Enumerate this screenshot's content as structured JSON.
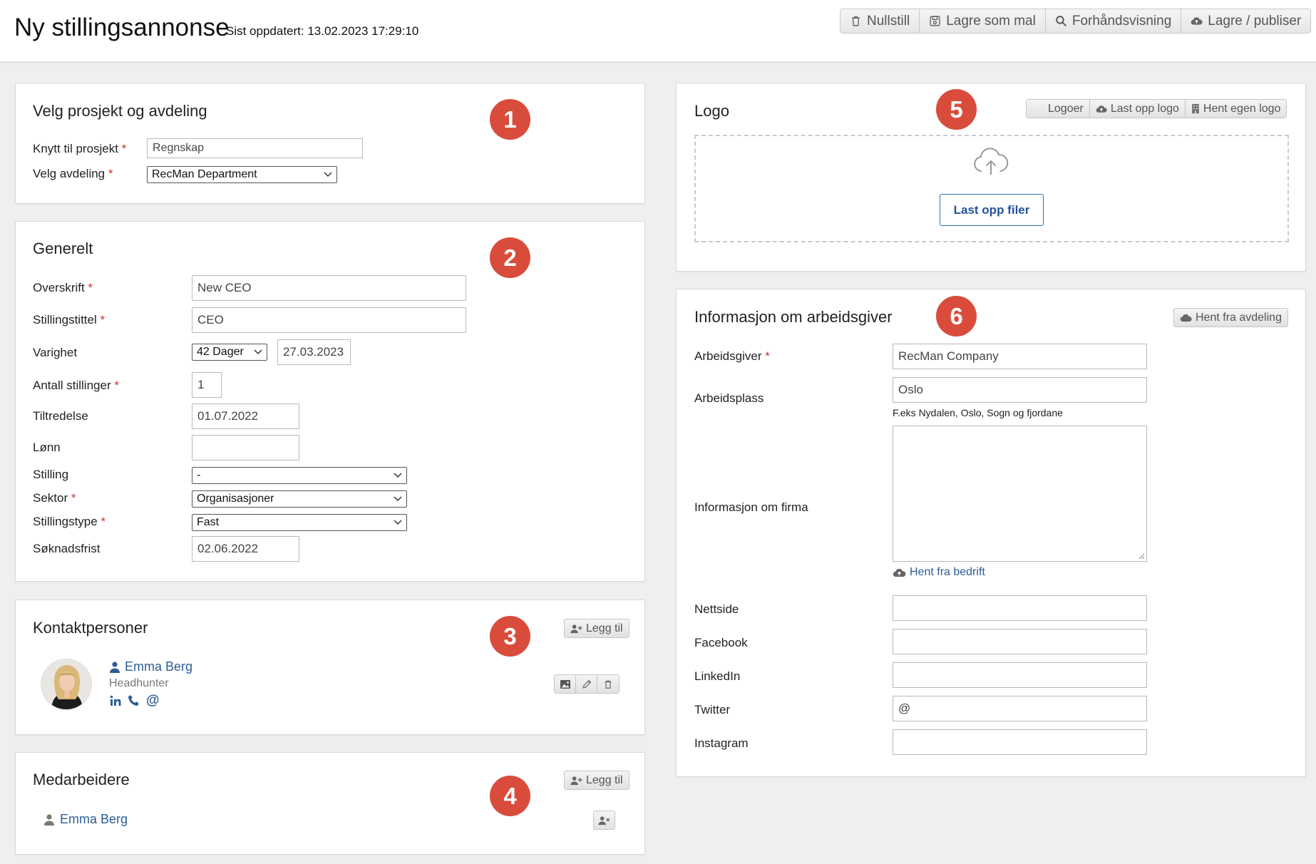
{
  "header": {
    "title": "Ny stillingsannonse",
    "last_updated": "Sist oppdatert: 13.02.2023 17:29:10",
    "toolbar": {
      "reset": "Nullstill",
      "save_template": "Lagre som mal",
      "preview": "Forhåndsvisning",
      "publish": "Lagre / publiser"
    }
  },
  "badges": [
    "1",
    "2",
    "3",
    "4",
    "5",
    "6"
  ],
  "project": {
    "title": "Velg prosjekt og avdeling",
    "project_label": "Knytt til prosjekt",
    "project_value": "Regnskap",
    "department_label": "Velg avdeling",
    "department_value": "RecMan Department"
  },
  "general": {
    "title": "Generelt",
    "headline_label": "Overskrift",
    "headline_value": "New CEO",
    "job_title_label": "Stillingstittel",
    "job_title_value": "CEO",
    "duration_label": "Varighet",
    "duration_value": "42 Dager",
    "duration_date": "27.03.2023",
    "positions_label": "Antall stillinger",
    "positions_value": "1",
    "start_label": "Tiltredelse",
    "start_value": "01.07.2022",
    "salary_label": "Lønn",
    "salary_value": "",
    "position_label": "Stilling",
    "position_value": "-",
    "sector_label": "Sektor",
    "sector_value": "Organisasjoner",
    "type_label": "Stillingstype",
    "type_value": "Fast",
    "deadline_label": "Søknadsfrist",
    "deadline_value": "02.06.2022"
  },
  "contacts": {
    "title": "Kontaktpersoner",
    "add_label": "Legg til",
    "person_name": "Emma Berg",
    "person_role": "Headhunter"
  },
  "colleagues": {
    "title": "Medarbeidere",
    "add_label": "Legg til",
    "person_name": "Emma Berg"
  },
  "logo": {
    "title": "Logo",
    "logos_label": "Logoer",
    "upload_logo_label": "Last opp logo",
    "own_logo_label": "Hent egen logo",
    "upload_files_label": "Last opp filer"
  },
  "employer": {
    "title": "Informasjon om arbeidsgiver",
    "fetch_department_label": "Hent fra avdeling",
    "employer_label": "Arbeidsgiver",
    "employer_value": "RecMan Company",
    "workplace_label": "Arbeidsplass",
    "workplace_value": "Oslo",
    "workplace_hint": "F.eks Nydalen, Oslo, Sogn og fjordane",
    "company_info_label": "Informasjon om firma",
    "fetch_company_label": "Hent fra bedrift",
    "website_label": "Nettside",
    "facebook_label": "Facebook",
    "linkedin_label": "LinkedIn",
    "twitter_label": "Twitter",
    "twitter_value": "@",
    "instagram_label": "Instagram"
  },
  "required_mark": "*",
  "colors": {
    "badge": "#d94c3b",
    "link": "#2c5d96",
    "required": "#d0322b",
    "primary_button": "#24529c"
  }
}
